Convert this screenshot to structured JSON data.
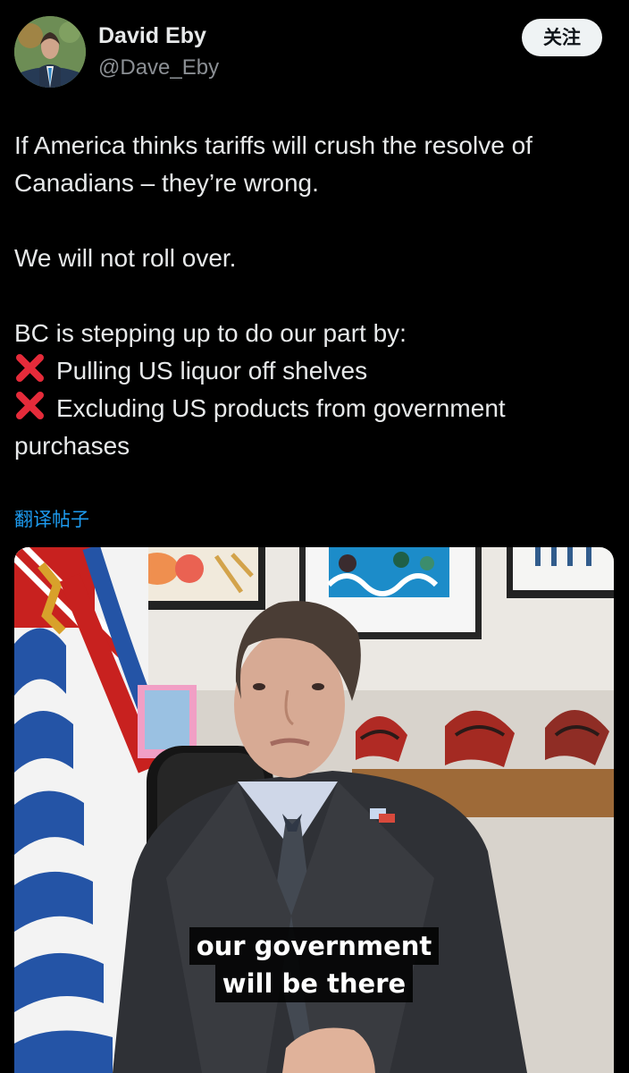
{
  "author": {
    "name": "David Eby",
    "handle": "@Dave_Eby",
    "avatar_icon": "profile-photo"
  },
  "follow_button": {
    "label": "关注"
  },
  "tweet": {
    "paragraphs": [
      "If America thinks tariffs will crush the resolve of Canadians – they’re wrong.",
      "We will not roll over.",
      "BC is stepping up to do our part by:"
    ],
    "list": [
      "Pulling US liquor off shelves",
      "Excluding US products from government purchases"
    ],
    "list_icon": "red-x-icon"
  },
  "translate_link": {
    "label": "翻译帖子"
  },
  "media": {
    "caption_line1": "our government",
    "caption_line2": "will be there"
  },
  "colors": {
    "background": "#000000",
    "text": "#e7e9ea",
    "secondary_text": "#8b8f94",
    "link": "#1d9bf0",
    "red_x": "#e52b3a"
  }
}
